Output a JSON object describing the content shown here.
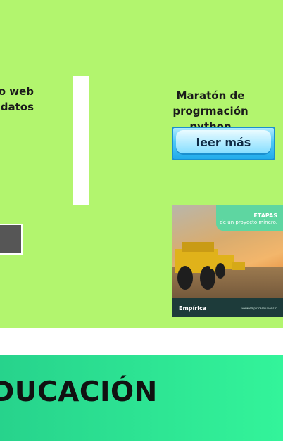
{
  "left_card": {
    "title_line1": "ño web",
    "title_line2": "datos"
  },
  "right_card": {
    "title_line1": "Maratón de progrmación",
    "title_line2": "python",
    "button_label": "leer más"
  },
  "ad": {
    "headline": "ETAPAS",
    "subhead": "de un proyecto minero.",
    "brand": "Empírica",
    "url": "www.empiricasolutions.cl"
  },
  "section": {
    "title": "DUCACIÓN"
  },
  "colors": {
    "page_green": "#b2f56e",
    "section_green": "#33f49a",
    "button_blue": "#1da9ea"
  }
}
